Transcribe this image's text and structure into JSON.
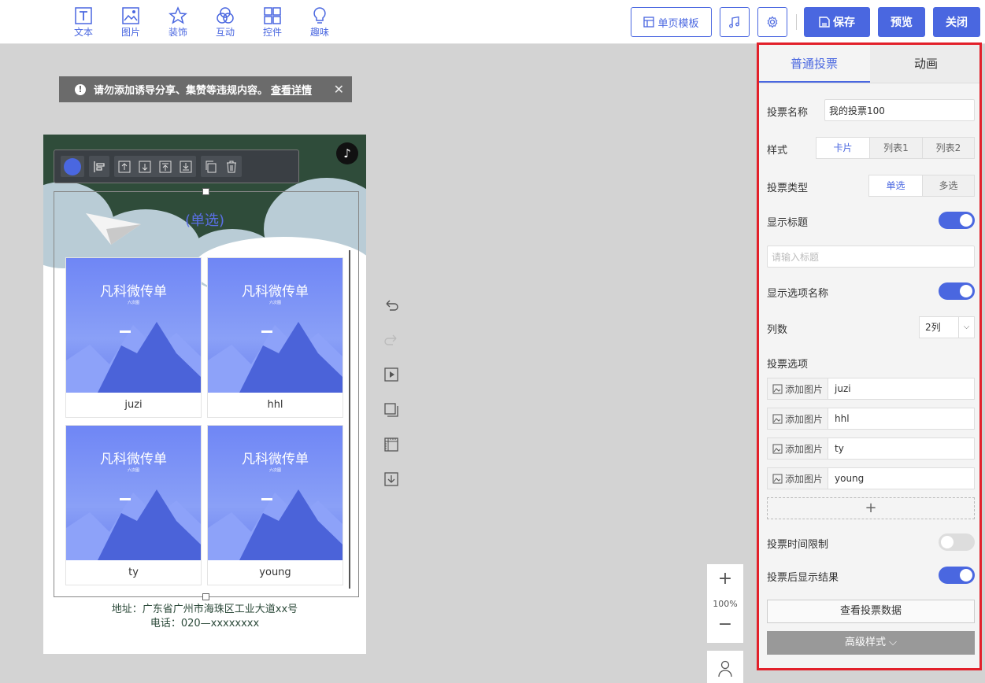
{
  "toolbar": {
    "tools": [
      {
        "label": "文本",
        "icon": "text-icon"
      },
      {
        "label": "图片",
        "icon": "image-icon"
      },
      {
        "label": "装饰",
        "icon": "star-icon"
      },
      {
        "label": "互动",
        "icon": "interact-icon"
      },
      {
        "label": "控件",
        "icon": "grid-icon"
      },
      {
        "label": "趣味",
        "icon": "bulb-icon"
      }
    ],
    "template_label": "单页模板",
    "save_label": "保存",
    "preview_label": "预览",
    "close_label": "关闭",
    "accent": "#4a67e0"
  },
  "notice": {
    "text": "请勿添加诱导分享、集赞等违规内容。",
    "link": "查看详情"
  },
  "canvas": {
    "vote_title": "(单选)",
    "card_title": "凡科微传单",
    "card_subtitle": "六次图",
    "options": [
      "juzi",
      "hhl",
      "ty",
      "young"
    ],
    "address": "地址：广东省广州市海珠区工业大道xx号",
    "phone": "电话：020—xxxxxxxx"
  },
  "zoom": {
    "level": "100%"
  },
  "panel": {
    "tabs": [
      "普通投票",
      "动画"
    ],
    "name_label": "投票名称",
    "name_value": "我的投票100",
    "style_label": "样式",
    "style_options": [
      "卡片",
      "列表1",
      "列表2"
    ],
    "type_label": "投票类型",
    "type_options": [
      "单选",
      "多选"
    ],
    "show_title_label": "显示标题",
    "title_placeholder": "请输入标题",
    "show_option_name_label": "显示选项名称",
    "columns_label": "列数",
    "columns_value": "2列",
    "options_label": "投票选项",
    "add_image_label": "添加图片",
    "options": [
      "juzi",
      "hhl",
      "ty",
      "young"
    ],
    "add_option_symbol": "+",
    "time_limit_label": "投票时间限制",
    "show_result_label": "投票后显示结果",
    "view_data_label": "查看投票数据",
    "advanced_label": "高级样式"
  }
}
